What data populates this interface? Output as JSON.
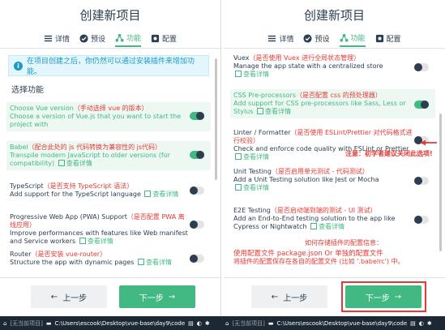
{
  "title": "创建新项目",
  "tabs": [
    {
      "label": "详情",
      "icon": "list-icon"
    },
    {
      "label": "预设",
      "icon": "check-circle-icon"
    },
    {
      "label": "功能",
      "icon": "features-icon"
    },
    {
      "label": "配置",
      "icon": "settings-icon"
    }
  ],
  "left": {
    "info": "在项目创建之后，你仍然可以通过安装插件来增加功能。",
    "section": "选择功能",
    "features": [
      {
        "name": "Choose Vue version",
        "cn": "（手动选择 vue 的版本）",
        "desc": "Choose a version of Vue.js that you want to start the project with",
        "more": "",
        "on": true,
        "selected": true
      },
      {
        "name": "Babel",
        "cn": "（配合此处的 js 代码转换为兼容性的 js代码）",
        "desc": "Transpile modern JavaScript to older versions (for compatibility)",
        "more": "查看详情",
        "on": true,
        "selected": true
      },
      {
        "name": "TypeScript",
        "cn": "（是否支持 TypeScript 语法）",
        "desc": "Add support for the TypeScript language",
        "more": "查看详情",
        "on": false,
        "selected": false
      },
      {
        "name": "Progressive Web App (PWA) Support",
        "cn": "（是否配置 PWA 离线应用）",
        "desc": "Improve performances with features like Web manifest and Service workers",
        "more": "查看详情",
        "on": false,
        "selected": false
      },
      {
        "name": "Router",
        "cn": "（是否安装 vue-router）",
        "desc": "Structure the app with dynamic pages",
        "more": "查看详情",
        "on": false,
        "selected": false
      }
    ],
    "prev_label": "上一步",
    "next_label": "下一步"
  },
  "right": {
    "features": [
      {
        "name": "Vuex",
        "cn": "（是否使用 Vuex 进行全局状态管理）",
        "desc": "Manage the app state with a centralized store",
        "more": "查看详情",
        "on": false,
        "selected": false
      },
      {
        "name": "CSS Pre-processors",
        "cn": "（是否配置 css 的预处理器）",
        "desc": "Add support for CSS pre-processors like Sass, Less or Stylus",
        "more": "查看详情",
        "on": true,
        "selected": true
      },
      {
        "name": "Linter / Formatter",
        "cn": "（是否使用 ESLint/Prettier 对代码格式进行校验）",
        "desc": "Check and enforce code quality with ESLint or Prettier",
        "more": "查看详情",
        "on": false,
        "selected": false
      },
      {
        "name": "Unit Testing",
        "cn": "（是否启用单元测试 - 代码测试）",
        "desc": "Add a Unit Testing solution like Jest or Mocha",
        "more": "查看详情",
        "on": false,
        "selected": false
      },
      {
        "name": "E2E Testing",
        "cn": "（是否启动端到端的测试 - UI 测试）",
        "desc": "Add an End-to-End testing solution to the app like Cypress or Nightwatch",
        "more": "查看详情",
        "on": false,
        "selected": false
      }
    ],
    "linter_note": "注意：初学者建议关闭此选项!",
    "plugin_title": "如何存储插件的配置信息：",
    "plugin_line1": "使用配置文件 package.json Or 单独的配置文件",
    "plugin_line2": "将插件的配置保存在各自的配置文件 (比如 '.babelrc') 中。",
    "prev_label": "上一步",
    "next_label": "下一步"
  },
  "taskbar": {
    "left_project": "[无当前项目]",
    "left_path": "C:\\Users\\escook\\Desktop\\vue-base\\day9\\code",
    "right_project": "[无当前项目]",
    "right_path": "C:\\Users\\escook\\Desktop\\vue-base\\day9\\code"
  },
  "colors": {
    "accent": "#42b983",
    "annotation": "#e53935",
    "text": "#2c3e50"
  }
}
